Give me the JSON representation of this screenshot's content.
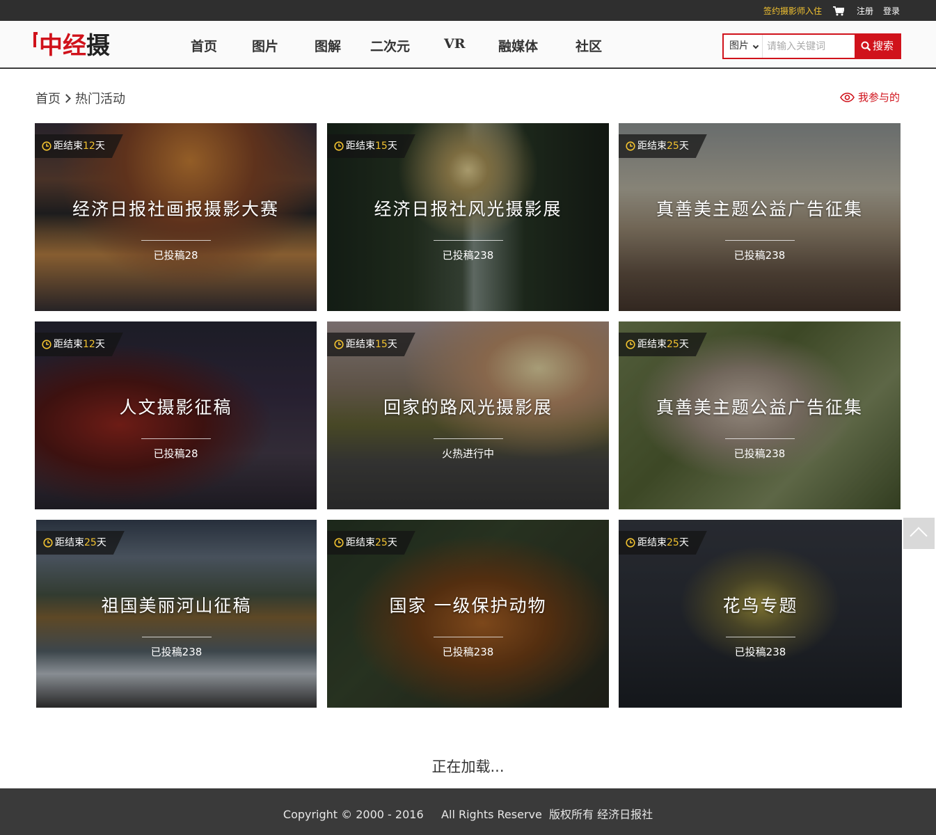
{
  "topbar": {
    "sign_link": "签约摄影师入住",
    "cart_icon": "cart-icon",
    "register": "注册",
    "login": "登录"
  },
  "header": {
    "logo_chars": [
      "中",
      "经",
      "摄"
    ],
    "nav": [
      "首页",
      "图片",
      "图解",
      "二次元",
      "VR",
      "融媒体",
      "社区"
    ],
    "search": {
      "category": "图片",
      "placeholder": "请输入关键词",
      "button": "搜索"
    }
  },
  "breadcrumb": {
    "home": "首页",
    "current": "热门活动"
  },
  "my_participation": "我参与的",
  "colors": {
    "brand_red": "#d0121b",
    "accent_yellow": "#f2c230",
    "topbar": "#2f2f2f",
    "footer": "#3a3a3a"
  },
  "cards": [
    {
      "tag_prefix": "距结束",
      "days": "12",
      "tag_suffix": "天",
      "title": "经济日报社画报摄影大赛",
      "sub": "已投稿28",
      "theme": "sunset-lake"
    },
    {
      "tag_prefix": "距结束",
      "days": "15",
      "tag_suffix": "天",
      "title": "经济日报社风光摄影展",
      "sub": "已投稿238",
      "theme": "waterfall"
    },
    {
      "tag_prefix": "距结束",
      "days": "25",
      "tag_suffix": "天",
      "title": "真善美主题公益广告征集",
      "sub": "已投稿238",
      "theme": "beach-kids"
    },
    {
      "tag_prefix": "距结束",
      "days": "12",
      "tag_suffix": "天",
      "title": "人文摄影征稿",
      "sub": "已投稿28",
      "theme": "street-rain"
    },
    {
      "tag_prefix": "距结束",
      "days": "15",
      "tag_suffix": "天",
      "title": "回家的路风光摄影展",
      "sub": "火热进行中",
      "theme": "road"
    },
    {
      "tag_prefix": "距结束",
      "days": "25",
      "tag_suffix": "天",
      "title": "真善美主题公益广告征集",
      "sub": "已投稿238",
      "theme": "lotus"
    },
    {
      "tag_prefix": "距结束",
      "days": "25",
      "tag_suffix": "天",
      "title": "祖国美丽河山征稿",
      "sub": "已投稿238",
      "theme": "mountain-river"
    },
    {
      "tag_prefix": "距结束",
      "days": "25",
      "tag_suffix": "天",
      "title": "国家 一级保护动物",
      "sub": "已投稿238",
      "theme": "tiger"
    },
    {
      "tag_prefix": "距结束",
      "days": "25",
      "tag_suffix": "天",
      "title": "花鸟专题",
      "sub": "已投稿238",
      "theme": "birds"
    }
  ],
  "loading": "正在加载...",
  "footer": "Copyright © 2000 - 2016     All Rights Reserve  版权所有 经济日报社"
}
